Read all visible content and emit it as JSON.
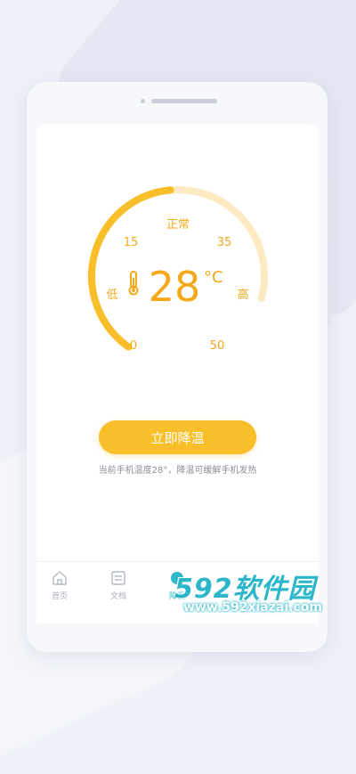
{
  "gauge": {
    "title": "正常",
    "low_label": "低",
    "high_label": "高",
    "tick_0": "0",
    "tick_15": "15",
    "tick_35": "35",
    "tick_50": "50",
    "temperature": "28",
    "unit": "°C",
    "value_fraction": 0.56,
    "active_color": "#f9bf2a",
    "track_color": "#fdeac2"
  },
  "action": {
    "button_label": "立即降温",
    "hint": "当前手机温度28°，降温可缓解手机发热"
  },
  "tabs": [
    {
      "label": "首页",
      "icon": "home-icon"
    },
    {
      "label": "文档",
      "icon": "document-icon"
    },
    {
      "label": "降温",
      "icon": "cool-icon"
    }
  ],
  "watermark": {
    "brand": "592软件园",
    "url": "www.592xiazai.com"
  }
}
